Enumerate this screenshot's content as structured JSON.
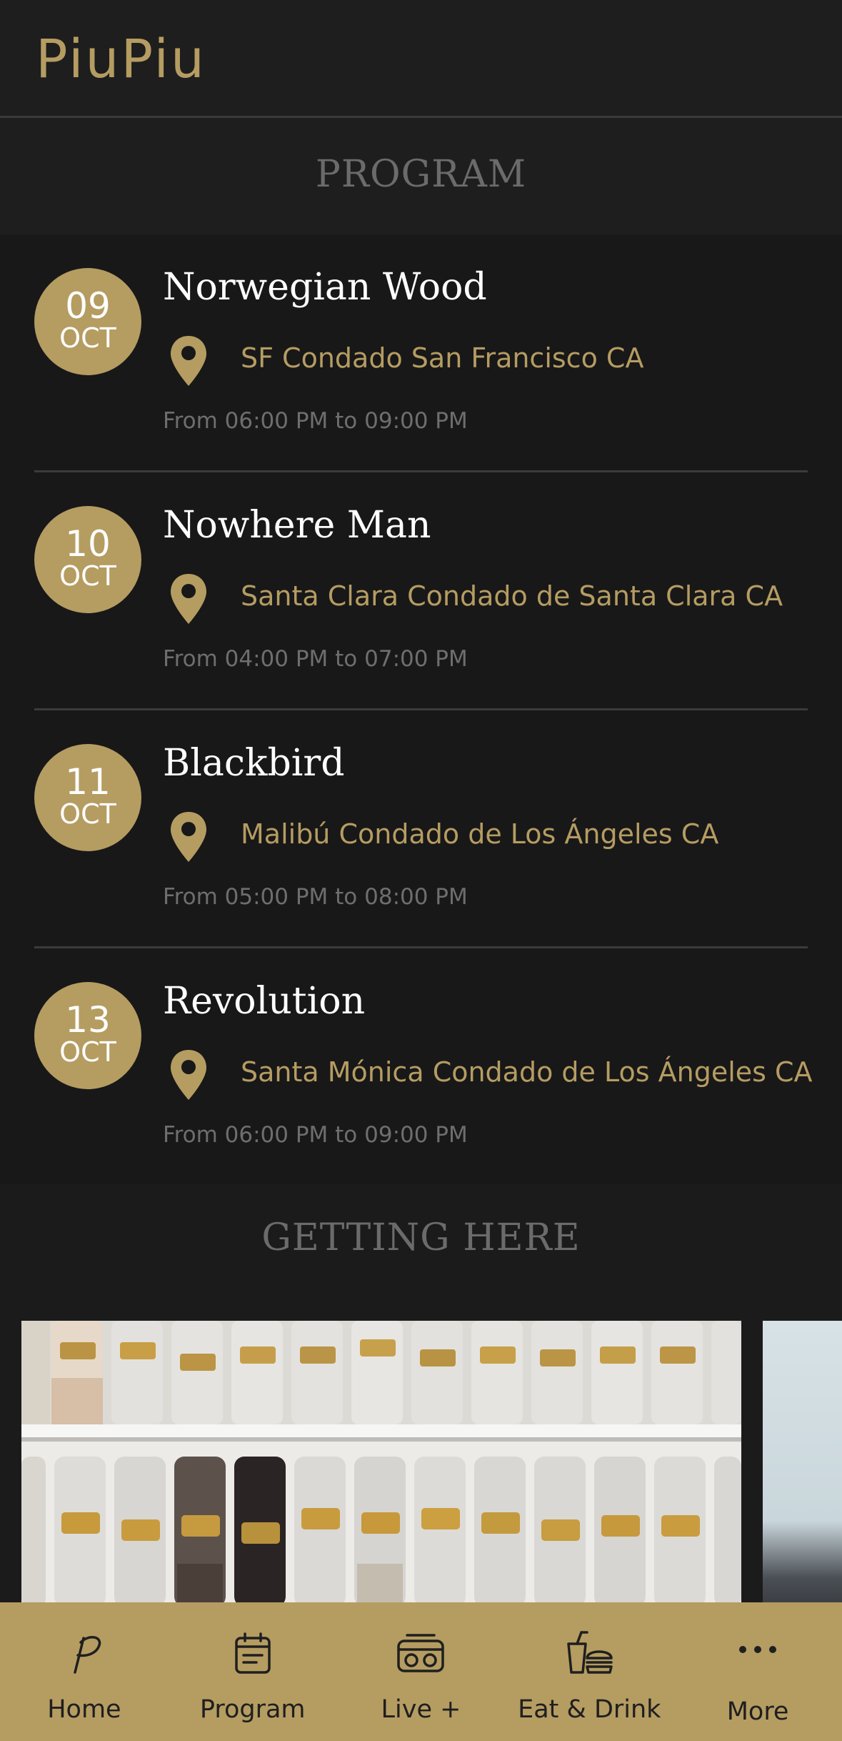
{
  "app": {
    "title": "PiuPiu",
    "accent_color": "#b59c61",
    "background_color": "#181819"
  },
  "program": {
    "heading": "PROGRAM",
    "events": [
      {
        "day": "09",
        "month": "OCT",
        "title": "Norwegian Wood",
        "location": "SF Condado San Francisco CA",
        "time": "From 06:00 PM to 09:00 PM",
        "icon": "location-pin-icon"
      },
      {
        "day": "10",
        "month": "OCT",
        "title": "Nowhere Man",
        "location": "Santa Clara Condado de Santa Clara CA",
        "time": "From 04:00 PM to 07:00 PM",
        "icon": "location-pin-icon"
      },
      {
        "day": "11",
        "month": "OCT",
        "title": "Blackbird",
        "location": "Malibú Condado de Los Ángeles CA",
        "time": "From 05:00 PM to 08:00 PM",
        "icon": "location-pin-icon"
      },
      {
        "day": "13",
        "month": "OCT",
        "title": "Revolution",
        "location": "Santa Mónica Condado de Los Ángeles CA",
        "time": "From 06:00 PM to 09:00 PM",
        "icon": "location-pin-icon"
      }
    ]
  },
  "getting_here": {
    "heading": "GETTING HERE"
  },
  "tabbar": {
    "tabs": [
      {
        "label": "Home",
        "icon": "home-logo-icon"
      },
      {
        "label": "Program",
        "icon": "calendar-icon"
      },
      {
        "label": "Live +",
        "icon": "radio-icon"
      },
      {
        "label": "Eat & Drink",
        "icon": "food-drink-icon"
      },
      {
        "label": "More",
        "icon": "more-dots-icon"
      }
    ]
  }
}
